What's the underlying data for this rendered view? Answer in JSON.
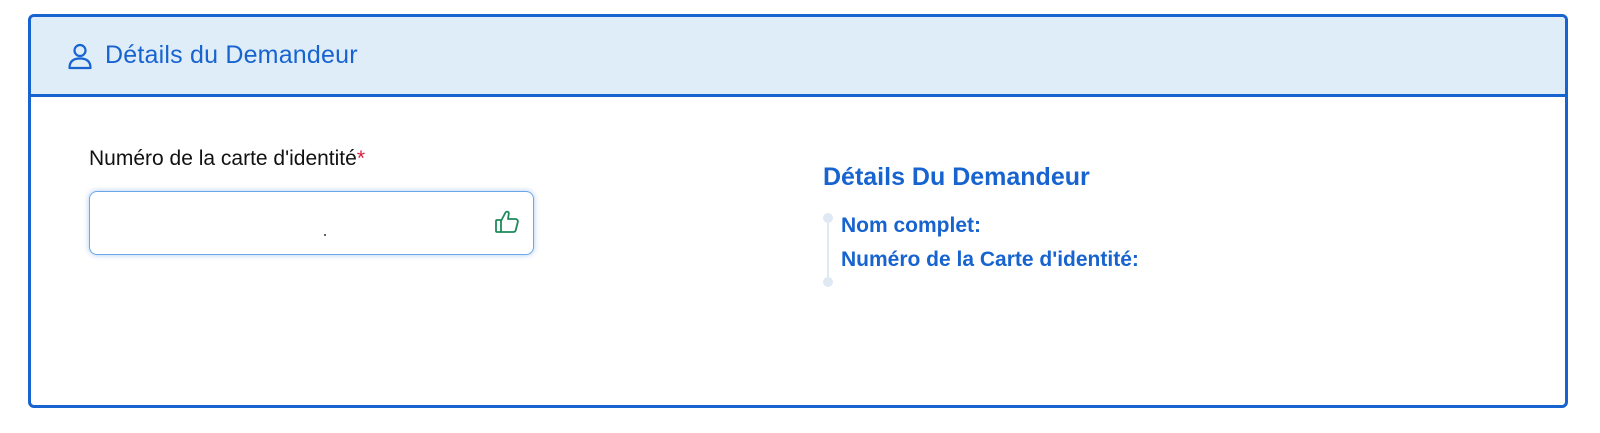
{
  "header": {
    "icon": "user-icon",
    "title": "Détails du Demandeur"
  },
  "form": {
    "id_label": "Numéro de la carte d'identité",
    "required_mark": "*",
    "id_value": "",
    "id_valid_icon": "thumbs-up-icon"
  },
  "details": {
    "title": "Détails Du Demandeur",
    "full_name_label": "Nom complet:",
    "id_card_label": "Numéro de la Carte d'identité:"
  },
  "colors": {
    "primary": "#1763cf",
    "header_bg": "#dfedf9",
    "required": "#d81b3c",
    "valid_icon": "#1e8a5a"
  }
}
